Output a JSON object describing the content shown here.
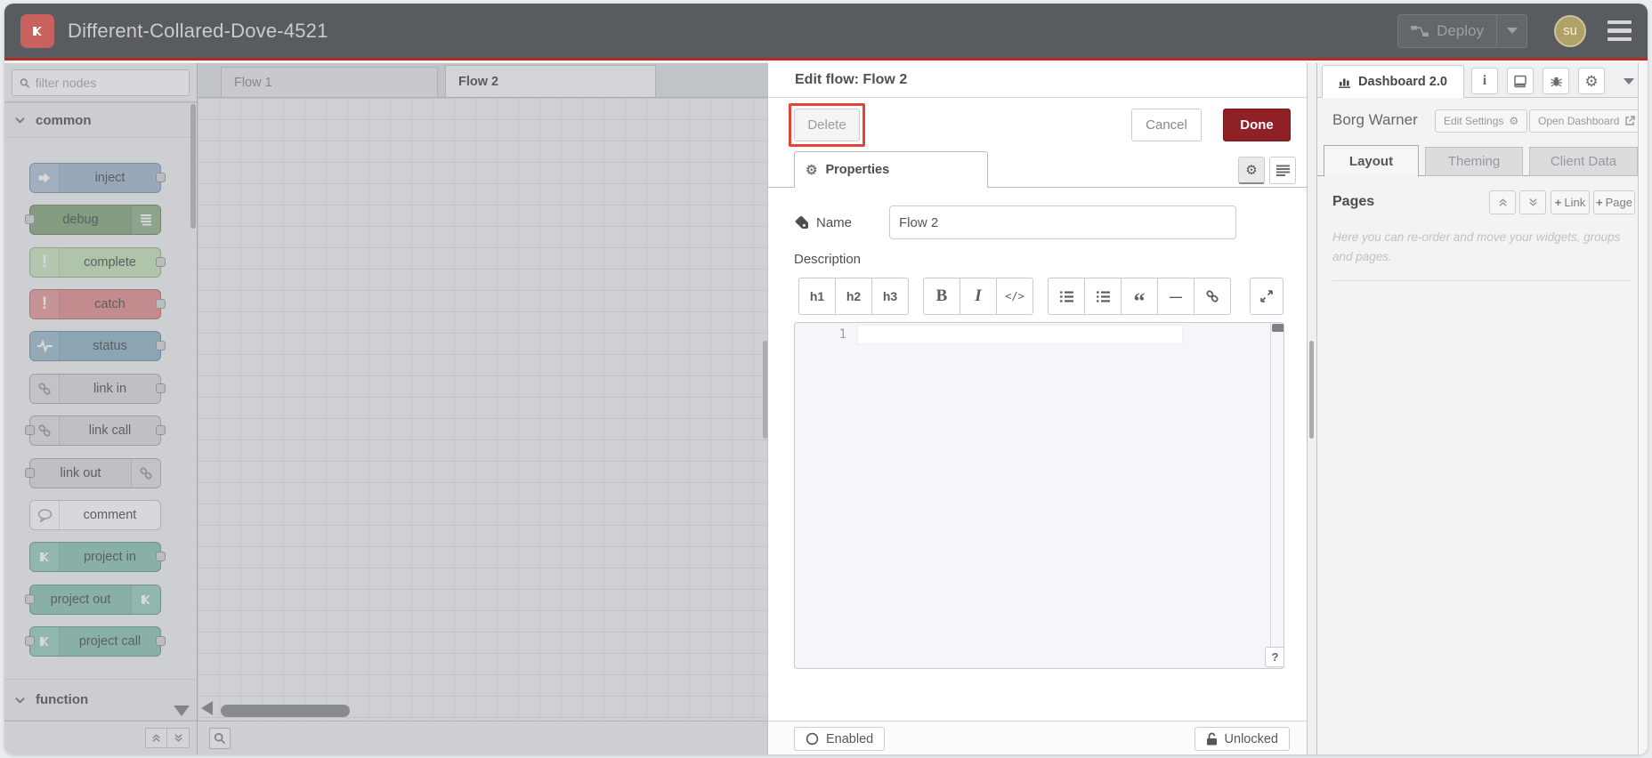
{
  "window": {
    "accent_red": "#b12b27",
    "highlight_red": "#e0443a",
    "header_bg": "#585c60",
    "done_red": "#8e2026",
    "avatar_gold": "#b0a267"
  },
  "header": {
    "title": "Different-Collared-Dove-4521",
    "deploy": {
      "label": "Deploy"
    },
    "user_initials": "su"
  },
  "palette": {
    "filter_placeholder": "filter nodes",
    "categories": [
      {
        "label": "common",
        "nodes": [
          {
            "label": "inject",
            "color": "#a6bbcf",
            "icon": "arrow-right-icon",
            "icon_side": "left",
            "ports": "out"
          },
          {
            "label": "debug",
            "color": "#87a980",
            "icon": "debug-list-icon",
            "icon_side": "right",
            "ports": "in"
          },
          {
            "label": "complete",
            "color": "#c7e3b8",
            "icon": "exclamation-icon",
            "icon_side": "left",
            "ports": "out"
          },
          {
            "label": "catch",
            "color": "#e49191",
            "icon": "exclamation-icon",
            "icon_side": "left",
            "ports": "out"
          },
          {
            "label": "status",
            "color": "#94b6c8",
            "icon": "pulse-icon",
            "icon_side": "left",
            "ports": "out"
          },
          {
            "label": "link in",
            "color": "#dddddd",
            "icon": "link-icon",
            "icon_side": "left",
            "ports": "out"
          },
          {
            "label": "link call",
            "color": "#dddddd",
            "icon": "link-icon",
            "icon_side": "left",
            "ports": "both"
          },
          {
            "label": "link out",
            "color": "#dddddd",
            "icon": "link-icon",
            "icon_side": "right",
            "ports": "in"
          },
          {
            "label": "comment",
            "color": "#ffffff",
            "icon": "comment-icon",
            "icon_side": "left",
            "ports": "none"
          },
          {
            "label": "project in",
            "color": "#8ec6b8",
            "icon": "node-red-icon",
            "icon_side": "left",
            "ports": "out"
          },
          {
            "label": "project out",
            "color": "#8ec6b8",
            "icon": "node-red-icon",
            "icon_side": "right",
            "ports": "in"
          },
          {
            "label": "project call",
            "color": "#8ec6b8",
            "icon": "node-red-icon",
            "icon_side": "left",
            "ports": "both"
          }
        ]
      },
      {
        "label": "function",
        "nodes": []
      }
    ]
  },
  "workspace": {
    "tabs": [
      {
        "label": "Flow 1",
        "active": false
      },
      {
        "label": "Flow 2",
        "active": true
      }
    ]
  },
  "tray": {
    "title": "Edit flow: Flow 2",
    "buttons": {
      "delete": "Delete",
      "cancel": "Cancel",
      "done": "Done"
    },
    "tabs": [
      {
        "label": "Properties",
        "active": true
      }
    ],
    "form": {
      "name_label": "Name",
      "name_value": "Flow 2",
      "description_label": "Description"
    },
    "editor": {
      "toolbar": {
        "heading_buttons": [
          "h1",
          "h2",
          "h3"
        ],
        "format_buttons": [
          "B",
          "I",
          "</>"
        ],
        "insert_icons": [
          "ordered-list-icon",
          "unordered-list-icon",
          "quote-icon",
          "horizontal-rule-icon",
          "link-icon"
        ],
        "expand_icon": "expand-icon"
      },
      "line_number": "1",
      "help_button": "?"
    },
    "footer": {
      "enabled": "Enabled",
      "unlocked": "Unlocked"
    }
  },
  "sidebar": {
    "tab": {
      "label": "Dashboard 2.0",
      "icon": "bar-chart-icon"
    },
    "toolbar_icons": [
      "info-icon",
      "book-icon",
      "bug-icon",
      "gear-icon",
      "chevron-down-icon"
    ],
    "dashboard_name": "Borg Warner",
    "edit_settings": "Edit Settings",
    "open_dashboard": "Open Dashboard",
    "tabs": [
      {
        "label": "Layout",
        "active": true
      },
      {
        "label": "Theming",
        "active": false
      },
      {
        "label": "Client Data",
        "active": false
      }
    ],
    "pages": {
      "heading": "Pages",
      "move_icons": [
        "angle-double-up-icon",
        "angle-double-down-icon"
      ],
      "plus_icon": "+",
      "add_link": "Link",
      "add_page": "Page",
      "help_text": "Here you can re-order and move your widgets, groups and pages."
    }
  },
  "icons": {
    "search": "magnifier",
    "quote": "“",
    "horizontal_rule": "—",
    "gear": "⚙",
    "enabled_circle": "○"
  }
}
